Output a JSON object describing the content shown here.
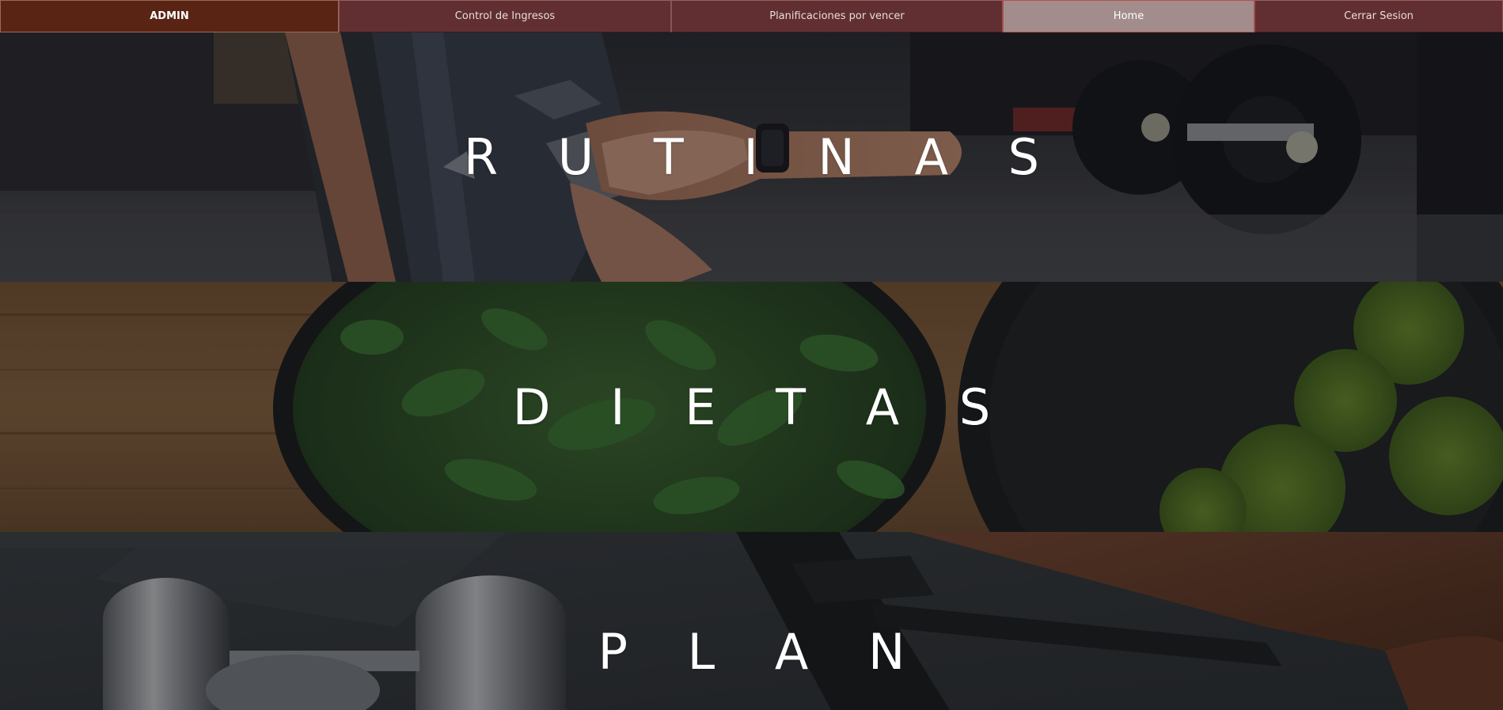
{
  "nav": {
    "items": [
      {
        "label": "ADMIN"
      },
      {
        "label": "Control de Ingresos"
      },
      {
        "label": "Planificaciones por vencer"
      },
      {
        "label": "Home"
      },
      {
        "label": "Cerrar Sesion"
      }
    ]
  },
  "sections": [
    {
      "title": "R U T I N A S"
    },
    {
      "title": "D I E T A S"
    },
    {
      "title": "P L A N"
    }
  ],
  "colors": {
    "nav_background": "#612e31",
    "admin_background": "#5a2414",
    "home_active_background": "#a28c8c",
    "title_text": "#ffffff"
  }
}
